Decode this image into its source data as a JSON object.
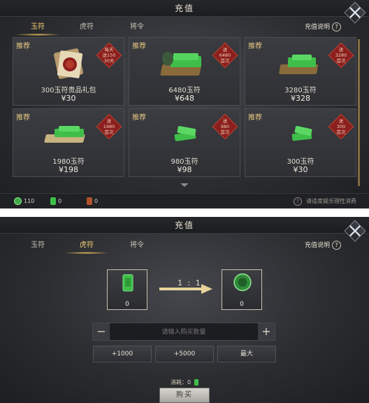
{
  "window": {
    "title": "充值"
  },
  "tabs": [
    "玉符",
    "虎符",
    "将令"
  ],
  "help_label": "充值说明",
  "help_glyph": "?",
  "top": {
    "cards": [
      {
        "tag": "推荐",
        "name": "300玉符贵品礼包",
        "price": "¥30",
        "ribbon": [
          "每天",
          "送150",
          "30天"
        ],
        "icon": "gift-package-icon"
      },
      {
        "tag": "推荐",
        "name": "6480玉符",
        "price": "¥648",
        "ribbon": [
          "送",
          "6480",
          "首次"
        ],
        "icon": "jade-pile-tray-icon"
      },
      {
        "tag": "推荐",
        "name": "3280玉符",
        "price": "¥328",
        "ribbon": [
          "送",
          "3280",
          "首次"
        ],
        "icon": "jade-tray-icon"
      },
      {
        "tag": "推荐",
        "name": "1980玉符",
        "price": "¥198",
        "ribbon": [
          "送",
          "1980",
          "首次"
        ],
        "icon": "jade-tray-icon"
      },
      {
        "tag": "推荐",
        "name": "980玉符",
        "price": "¥98",
        "ribbon": [
          "送",
          "980",
          "首次"
        ],
        "icon": "jade-stack-icon"
      },
      {
        "tag": "推荐",
        "name": "300玉符",
        "price": "¥30",
        "ribbon": [
          "送",
          "300",
          "首次"
        ],
        "icon": "jade-stack-icon"
      }
    ],
    "currencies": [
      {
        "icon": "jade-coin-icon",
        "value": "110"
      },
      {
        "icon": "jade-token-icon",
        "value": "0"
      },
      {
        "icon": "tiger-token-icon",
        "value": "0"
      }
    ],
    "notice": "请适度娱乐理性消费"
  },
  "bottom": {
    "from_count": "0",
    "to_count": "0",
    "ratio": "1 : 1",
    "minus": "−",
    "plus": "+",
    "input_placeholder": "请输入购买数量",
    "quick_buttons": [
      "+1000",
      "+5000",
      "最大"
    ],
    "consume_label": "消耗：0",
    "buy_label": "购买"
  },
  "colors": {
    "accent": "#f3cd72",
    "ribbon": "#8b1e1e",
    "jade": "#3fbf4a"
  }
}
